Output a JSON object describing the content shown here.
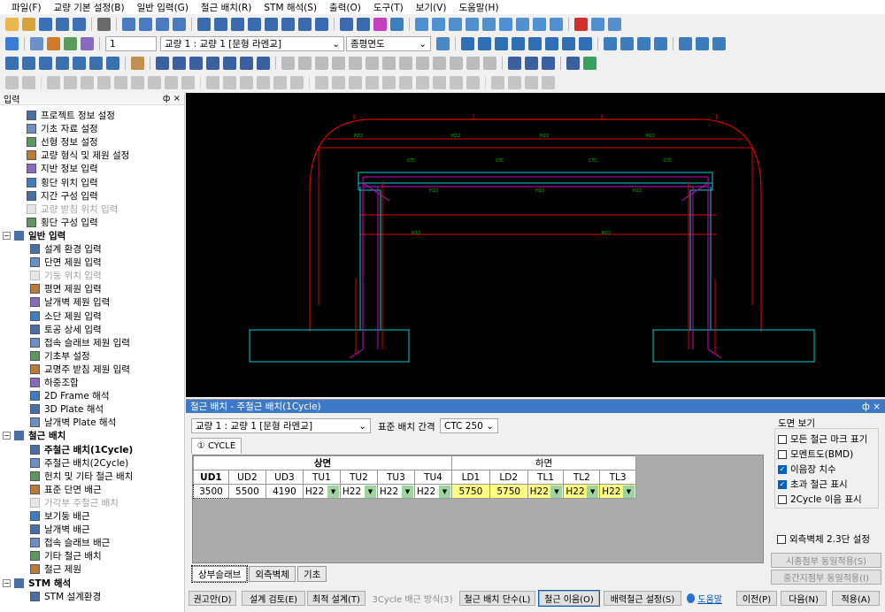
{
  "menu": [
    "파일(F)",
    "교량 기본 설정(B)",
    "일반 입력(G)",
    "철근 배치(R)",
    "STM 해석(S)",
    "출력(O)",
    "도구(T)",
    "보기(V)",
    "도움말(H)"
  ],
  "toolbar2": {
    "page_value": "1",
    "bridge_select": "교량 1 : 교량 1 [문형 라멘교]",
    "view_select": "종평면도"
  },
  "left_panel": {
    "title": "입력",
    "pin": "ф ×",
    "items": [
      {
        "label": "프로젝트 정보 설정",
        "enabled": true
      },
      {
        "label": "기초 자료 설정",
        "enabled": true
      },
      {
        "label": "선형 정보 설정",
        "enabled": true
      },
      {
        "label": "교량 형식 및 제원 설정",
        "enabled": true
      },
      {
        "label": "지반 정보 입력",
        "enabled": true
      },
      {
        "label": "횡단 위치 입력",
        "enabled": true
      },
      {
        "label": "지간 구성 입력",
        "enabled": true
      },
      {
        "label": "교량 받침 위치 입력",
        "enabled": false
      },
      {
        "label": "횡단 구성 입력",
        "enabled": true
      }
    ],
    "group_general": "일반 입력",
    "general_items": [
      {
        "label": "설계 환경 입력",
        "enabled": true
      },
      {
        "label": "단면 제원 입력",
        "enabled": true
      },
      {
        "label": "기둥 위치 입력",
        "enabled": false
      },
      {
        "label": "평면 제원 입력",
        "enabled": true
      },
      {
        "label": "날개벽 제원 입력",
        "enabled": true
      },
      {
        "label": "소단 제원 입력",
        "enabled": true
      },
      {
        "label": "토공 상세 입력",
        "enabled": true
      },
      {
        "label": "접속 슬래브 제원 입력",
        "enabled": true
      },
      {
        "label": "기초부 설정",
        "enabled": true
      },
      {
        "label": "교명주 받침 제원 입력",
        "enabled": true
      },
      {
        "label": "하중조합",
        "enabled": true
      },
      {
        "label": "2D Frame 해석",
        "enabled": true
      },
      {
        "label": "3D Plate 해석",
        "enabled": true
      },
      {
        "label": "날개벽 Plate 해석",
        "enabled": true
      }
    ],
    "group_rebar": "철근 배치",
    "rebar_items": [
      {
        "label": "주철근 배치(1Cycle)",
        "enabled": true,
        "bold": true
      },
      {
        "label": "주철근 배치(2Cycle)",
        "enabled": true
      },
      {
        "label": "헌치 및 기타 철근 배치",
        "enabled": true
      },
      {
        "label": "표준 단면 배근",
        "enabled": true
      },
      {
        "label": "가각부 주철근 배치",
        "enabled": false
      },
      {
        "label": "보기둥 배근",
        "enabled": true
      },
      {
        "label": "날개벽 배근",
        "enabled": true
      },
      {
        "label": "접속 슬래브 배근",
        "enabled": true
      },
      {
        "label": "기타 철근 배치",
        "enabled": true
      },
      {
        "label": "철근 제원",
        "enabled": true
      }
    ],
    "group_stm": "STM 해석",
    "stm_items": [
      {
        "label": "STM 설계환경",
        "enabled": true
      }
    ]
  },
  "dialog": {
    "title": "철근 배치 - 주철근 배치(1Cycle)",
    "pin": "ф ×",
    "bridge_select": "교량 1 : 교량 1 [문형 라멘교]",
    "spacing_label": "표준 배치 간격",
    "spacing_select": "CTC 250",
    "tab": "① CYCLE",
    "group_top": "상면",
    "group_bottom": "하면",
    "columns": [
      "UD1",
      "UD2",
      "UD3",
      "TU1",
      "TU2",
      "TU3",
      "TU4",
      "LD1",
      "LD2",
      "TL1",
      "TL2",
      "TL3"
    ],
    "values": [
      "3500",
      "5500",
      "4190",
      "H22",
      "H22",
      "H22",
      "H22",
      "5750",
      "5750",
      "H22",
      "H22",
      "H22"
    ],
    "bottom_tabs": [
      "상부슬래브",
      "외측벽체",
      "기초"
    ],
    "view_title": "도면 보기",
    "view_options": [
      {
        "label": "모든 철근 마크 표기",
        "checked": false
      },
      {
        "label": "모멘트도(BMD)",
        "checked": false
      },
      {
        "label": "이음장 치수",
        "checked": true
      },
      {
        "label": "초과 철근 표시",
        "checked": true
      },
      {
        "label": "2Cycle 이음 표시",
        "checked": false
      }
    ],
    "outer_wall_option": {
      "label": "외측벽체 2.3단 설정",
      "checked": false
    },
    "side_buttons": [
      "시종점부 동일적용(S)",
      "중간지점부 동일적용(I)"
    ],
    "buttons": [
      "권고안(D)",
      "설계 검토(E)",
      "최적 설계(T)",
      "3Cycle 배근 방식(3)",
      "철근 배치 단수(L)",
      "철근 이음(O)",
      "배력철근 설정(S)",
      "도움말",
      "이전(P)",
      "다음(N)",
      "적용(A)"
    ]
  }
}
